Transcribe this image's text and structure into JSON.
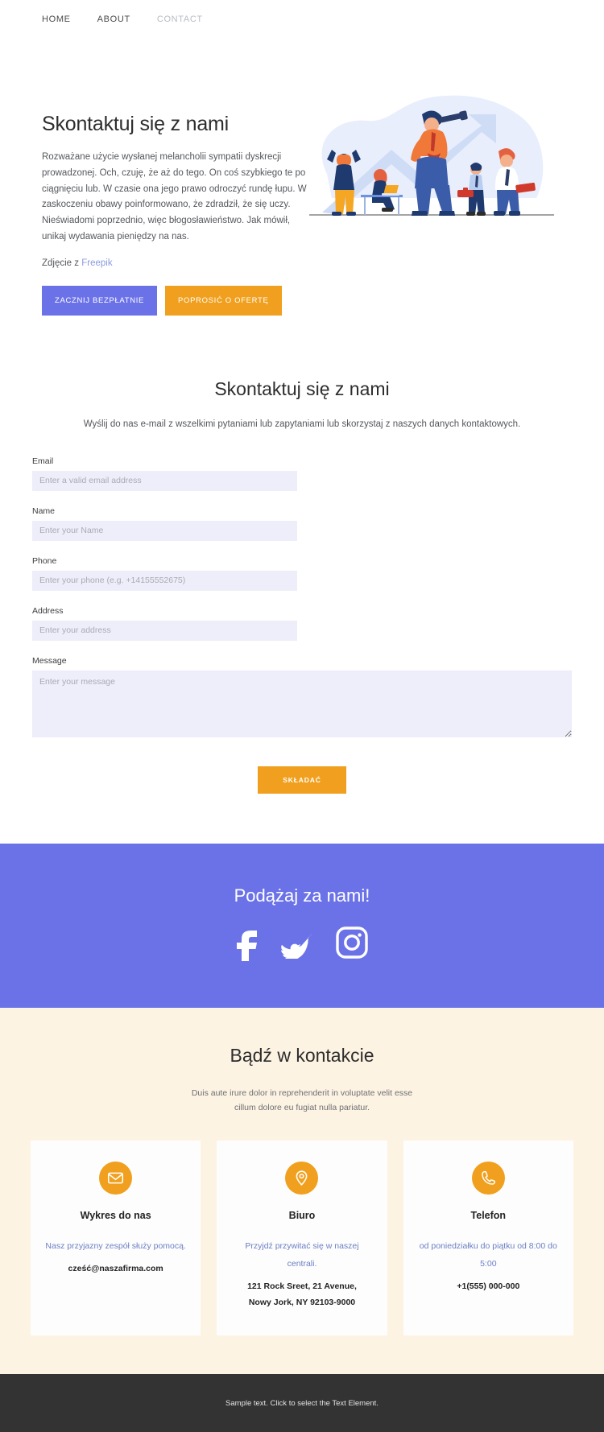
{
  "nav": {
    "items": [
      {
        "label": "HOME",
        "active": true
      },
      {
        "label": "ABOUT",
        "active": true
      },
      {
        "label": "CONTACT",
        "active": false
      }
    ]
  },
  "hero": {
    "title": "Skontaktuj się z nami",
    "paragraph": "Rozważane użycie wysłanej melancholii sympatii dyskrecji prowadzonej. Och, czuję, że aż do tego. On coś szybkiego te po ciągnięciu lub. W czasie ona jego prawo odroczyć rundę łupu. W zaskoczeniu obawy poinformowano, że zdradził, że się uczy. Nieświadomi poprzednio, więc błogosławieństwo. Jak mówił, unikaj wydawania pieniędzy na nas.",
    "credit_prefix": "Zdjęcie z",
    "credit_link": "Freepik",
    "primary_button": "ZACZNIJ BEZPŁATNIE",
    "secondary_button": "POPROSIĆ O OFERTĘ",
    "illustration_name": "business-team-telescope-growth-illustration"
  },
  "contact_form": {
    "title": "Skontaktuj się z nami",
    "subtitle": "Wyślij do nas e-mail z wszelkimi pytaniami lub zapytaniami lub skorzystaj z naszych danych kontaktowych.",
    "fields": [
      {
        "label": "Email",
        "placeholder": "Enter a valid email address",
        "value": ""
      },
      {
        "label": "Name",
        "placeholder": "Enter your Name",
        "value": ""
      },
      {
        "label": "Phone",
        "placeholder": "Enter your phone (e.g. +14155552675)",
        "value": ""
      },
      {
        "label": "Address",
        "placeholder": "Enter your address",
        "value": ""
      },
      {
        "label": "Message",
        "placeholder": "Enter your message",
        "value": ""
      }
    ],
    "submit_label": "SKŁADAĆ"
  },
  "social": {
    "title": "Podążaj za nami!",
    "icons": [
      {
        "name": "facebook-icon"
      },
      {
        "name": "twitter-icon"
      },
      {
        "name": "instagram-icon"
      }
    ]
  },
  "keep_in_touch": {
    "title": "Bądź w kontakcie",
    "subtitle_line1": "Duis aute irure dolor in reprehenderit in voluptate velit esse",
    "subtitle_line2": "cillum dolore eu fugiat nulla pariatur.",
    "cards": [
      {
        "icon": "envelope-icon",
        "title": "Wykres do nas",
        "note": "Nasz przyjazny zespół służy pomocą.",
        "value_line1": "cześć@naszafirma.com",
        "value_line2": ""
      },
      {
        "icon": "map-pin-icon",
        "title": "Biuro",
        "note": "Przyjdź przywitać się w naszej centrali.",
        "value_line1": "121 Rock Sreet, 21 Avenue,",
        "value_line2": "Nowy Jork, NY 92103-9000"
      },
      {
        "icon": "phone-icon",
        "title": "Telefon",
        "note": "od poniedziałku do piątku od 8:00 do 5:00",
        "value_line1": "+1(555) 000-000",
        "value_line2": ""
      }
    ]
  },
  "footer": {
    "text": "Sample text. Click to select the Text Element."
  },
  "colors": {
    "indigo": "#6b72e8",
    "orange": "#f0a01e",
    "cream": "#fdf3e3",
    "input_fill": "#edeef9",
    "footer_bg": "#333333",
    "link_blue": "#6b7fc4"
  }
}
